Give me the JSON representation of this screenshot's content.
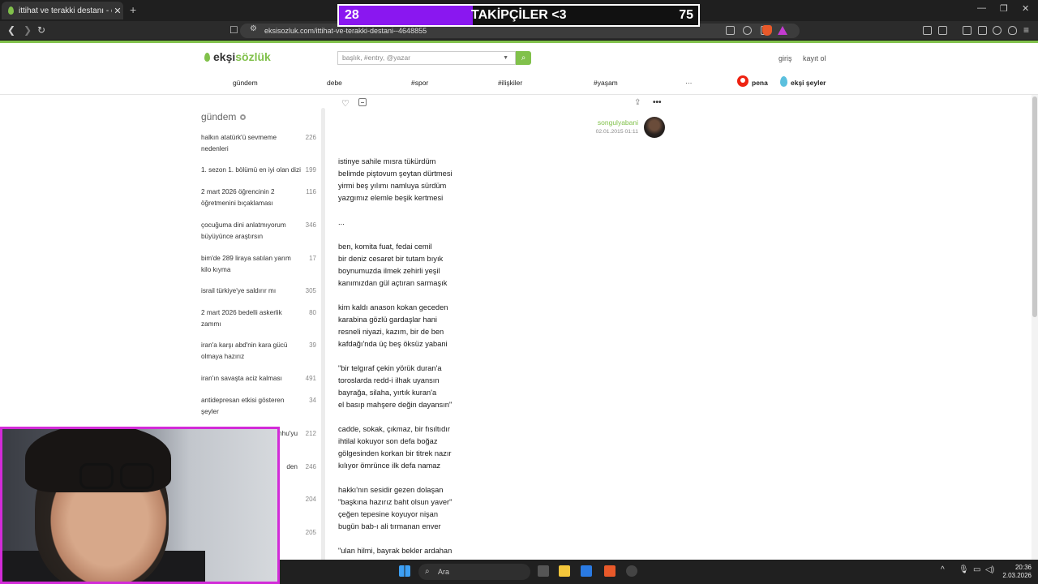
{
  "browser": {
    "tab_title": "ittihat ve terakki destanı - ekşi sö",
    "url": "eksisozluk.com/ittihat-ve-terakki-destani--4648855"
  },
  "overlay": {
    "current": "28",
    "label": "TAKİPÇİLER <3",
    "goal": "75",
    "progress": 0.3733
  },
  "header": {
    "logo_text_a": "ekşi",
    "logo_text_b": "sözlük",
    "search_placeholder": "başlık, #entry, @yazar",
    "login": "giriş",
    "register": "kayıt ol"
  },
  "topnav": {
    "items": [
      "gündem",
      "debe",
      "#spor",
      "#ilişkiler",
      "#yaşam",
      "···"
    ],
    "pena": "pena",
    "eksi_seyler": "ekşi şeyler"
  },
  "sidebar": {
    "title": "gündem",
    "items": [
      {
        "text": "halkın atatürk'ü sevmeme nedenleri",
        "count": "226"
      },
      {
        "text": "1. sezon 1. bölümü en iyi olan dizi",
        "count": "199"
      },
      {
        "text": "2 mart 2026 öğrencinin 2 öğretmenini bıçaklaması",
        "count": "116"
      },
      {
        "text": "çocuğuma dini anlatmıyorum büyüyünce araştırsın",
        "count": "346"
      },
      {
        "text": "bim'de 289 liraya satılan yarım kilo kıyma",
        "count": "17"
      },
      {
        "text": "israil türkiye'ye saldırır mı",
        "count": "305"
      },
      {
        "text": "2 mart 2026 bedelli askerlik zammı",
        "count": "80"
      },
      {
        "text": "iran'a karşı abd'nin kara gücü olmaya hazırız",
        "count": "39"
      },
      {
        "text": "iran'ın savaşta aciz kalması",
        "count": "491"
      },
      {
        "text": "antidepresan etkisi gösteren şeyler",
        "count": "34"
      },
      {
        "text": "nhu'yu",
        "count": "212"
      },
      {
        "text": "den",
        "count": "246"
      },
      {
        "text": "",
        "count": "204"
      },
      {
        "text": "",
        "count": "205"
      }
    ]
  },
  "entry": {
    "author": "songulyabani",
    "date": "02.01.2015 01:11",
    "lines": [
      "istinye sahile mısra tükürdüm",
      "belimde piştovum şeytan dürtmesi",
      "yirmi beş yılımı namluya sürdüm",
      "yazgımız elemle beşik kertmesi",
      "",
      "...",
      "",
      "ben, komita fuat, fedai cemil",
      "bir deniz cesaret bir tutam bıyık",
      "boynumuzda ilmek zehirli yeşil",
      "kanımızdan gül açtıran sarmaşık",
      "",
      "kim kaldı anason kokan geceden",
      "karabina gözlü gardaşlar hani",
      "resneli niyazi, kazım, bir de ben",
      "kafdağı'nda üç beş öksüz yabani",
      "",
      "\"bir telgıraf çekin yörük duran'a",
      "toroslarda redd-i ilhak uyansın",
      "bayrağa, silaha, yırtık kuran'a",
      "el basıp mahşere değin dayansın\"",
      "",
      "cadde, sokak, çıkmaz, bir fısıltıdır",
      "ihtilal kokuyor son defa boğaz",
      "gölgesinden korkan bir titrek nazır",
      "kılıyor ömrünce ilk defa namaz",
      "",
      "hakkı'nın sesidir gezen dolaşan",
      "\"başkına hazırız baht olsun yaver\"",
      "çeğen tepesine koyuyor nişan",
      "bugün bab-ı ali tırmanan enver",
      "",
      "\"ulan hilmi, bayrak bekler ardahan"
    ]
  },
  "taskbar": {
    "search": "Ara",
    "time": "20:36",
    "date": "2.03.2026"
  }
}
